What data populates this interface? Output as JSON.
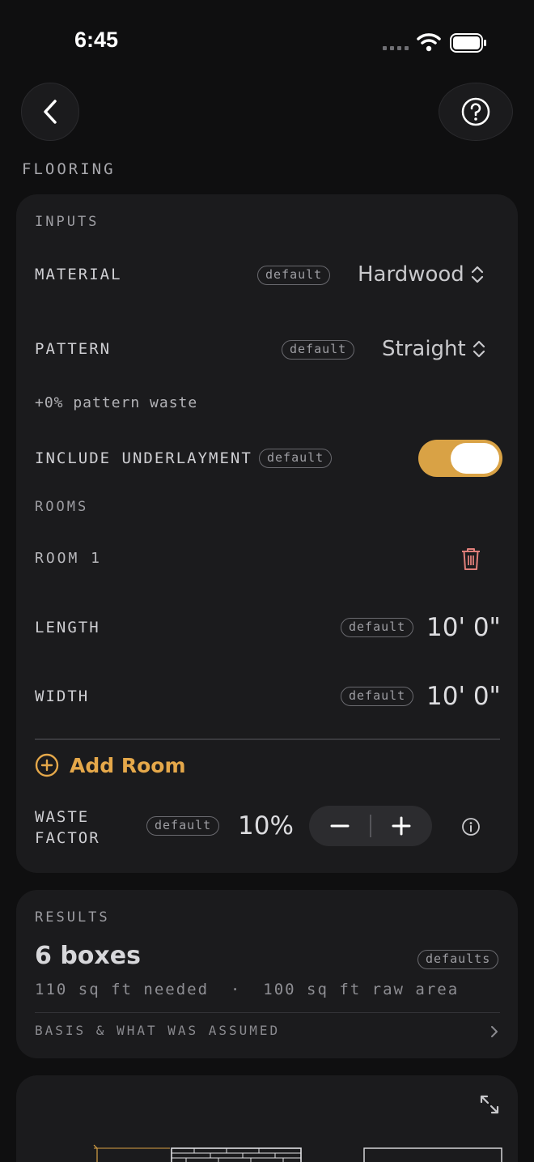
{
  "status_bar": {
    "time": "6:45"
  },
  "header": {
    "section": "FLOORING"
  },
  "inputs": {
    "heading": "INPUTS",
    "material": {
      "label": "MATERIAL",
      "badge": "default",
      "value": "Hardwood"
    },
    "pattern": {
      "label": "PATTERN",
      "badge": "default",
      "value": "Straight",
      "note": "+0% pattern waste"
    },
    "underlayment": {
      "label": "INCLUDE UNDERLAYMENT",
      "badge": "default",
      "enabled": true
    },
    "rooms": {
      "heading": "ROOMS",
      "items": [
        {
          "name": "ROOM 1",
          "length": {
            "label": "LENGTH",
            "badge": "default",
            "value": "10' 0\""
          },
          "width": {
            "label": "WIDTH",
            "badge": "default",
            "value": "10' 0\""
          }
        }
      ],
      "add_label": "Add Room"
    },
    "waste": {
      "label_line1": "WASTE",
      "label_line2": "FACTOR",
      "badge": "default",
      "value": "10%"
    }
  },
  "results": {
    "heading": "RESULTS",
    "boxes": "6 boxes",
    "badge": "defaults",
    "needed": "110 sq ft needed",
    "separator": "·",
    "raw_area": "100 sq ft raw area",
    "basis_label": "BASIS & WHAT WAS ASSUMED"
  },
  "colors": {
    "accent": "#d9a245",
    "accent_text": "#e5a84a",
    "delete": "#e07f7a",
    "card": "#1b1b1d",
    "background": "#0f0f10"
  },
  "icons": [
    "back-chevron-icon",
    "help-circle-icon",
    "updown-chevron-icon",
    "trash-icon",
    "plus-circle-icon",
    "minus-icon",
    "plus-icon",
    "info-icon",
    "chevron-right-icon",
    "expand-icon"
  ]
}
